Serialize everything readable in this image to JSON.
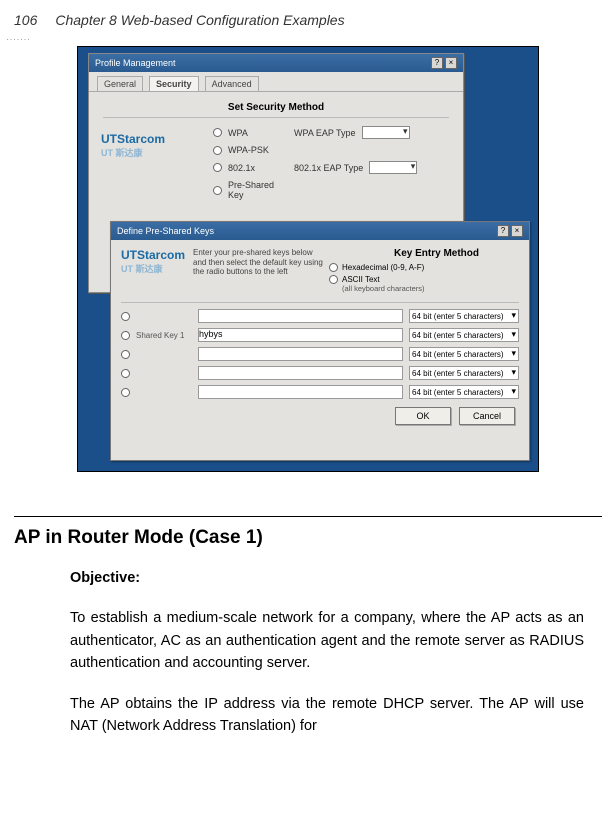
{
  "header": {
    "page_number": "106",
    "chapter_title": "Chapter 8 Web-based Configuration Examples"
  },
  "figure": {
    "win1": {
      "title": "Profile Management",
      "tabs": [
        "General",
        "Security",
        "Advanced"
      ],
      "section_heading": "Set Security Method",
      "logo": {
        "brand": "UTStarcom",
        "sub": "UT 斯达康"
      },
      "options": [
        {
          "label": "WPA",
          "eap_label": "WPA EAP Type",
          "has_dd": true
        },
        {
          "label": "WPA-PSK"
        },
        {
          "label": "802.1x",
          "eap_label": "802.1x EAP Type",
          "has_dd": true
        },
        {
          "label": "Pre-Shared Key"
        }
      ]
    },
    "win2": {
      "title": "Define Pre-Shared Keys",
      "logo": {
        "brand": "UTStarcom",
        "sub": "UT 斯达康"
      },
      "instructions": "Enter your pre-shared keys below and then select the default key using the radio buttons to the left",
      "kem_heading": "Key Entry Method",
      "kem_options": [
        {
          "label": "Hexadecimal (0-9, A-F)"
        },
        {
          "label": "ASCII Text",
          "sub": "(all keyboard characters)"
        }
      ],
      "rows": [
        {
          "label": "",
          "value": "",
          "select": "64 bit (enter 5 characters)"
        },
        {
          "label": "Shared Key 1",
          "value": "hybys",
          "select": "64 bit (enter 5 characters)"
        },
        {
          "label": "",
          "value": "",
          "select": "64 bit (enter 5 characters)"
        },
        {
          "label": "",
          "value": "",
          "select": "64 bit (enter 5 characters)"
        },
        {
          "label": "",
          "value": "",
          "select": "64 bit (enter 5 characters)"
        }
      ],
      "buttons": {
        "ok": "OK",
        "cancel": "Cancel"
      }
    }
  },
  "section": {
    "title": "AP in Router Mode (Case 1)",
    "objective_label": "Objective",
    "para1": "To establish a medium-scale network for a company, where the AP acts as an authenticator, AC as an authentication agent and the remote server as RADIUS authentication and accounting server.",
    "para2": "The AP obtains the IP address via the remote DHCP server. The AP will use NAT (Network Address Translation) for"
  }
}
